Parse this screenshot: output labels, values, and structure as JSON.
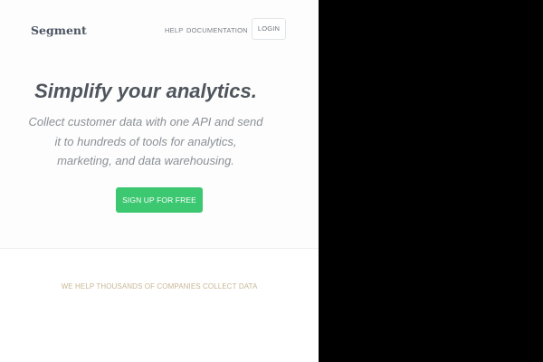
{
  "header": {
    "logo": "Segment",
    "nav": {
      "help": "HELP",
      "documentation": "DOCUMENTATION",
      "login": "LOGIN"
    }
  },
  "hero": {
    "headline": "Simplify your analytics.",
    "subheadline_lines": [
      "Collect customer data with one API and send",
      "it to hundreds of tools for analytics,",
      "marketing, and data warehousing."
    ],
    "cta_label": "SIGN UP FOR FREE"
  },
  "companies": {
    "tagline": "WE HELP THOUSANDS OF COMPANIES COLLECT DATA"
  },
  "colors": {
    "cta_green": "#3cc771",
    "tagline_tan": "#c8b796",
    "page_background": "#ffffff",
    "outside_viewport": "#000000"
  }
}
